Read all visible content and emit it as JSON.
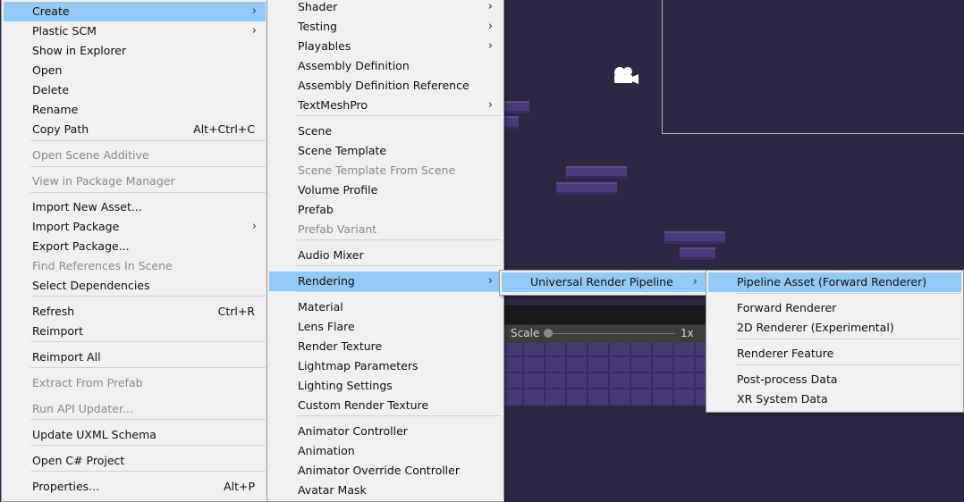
{
  "scene": {
    "scale_label": "Scale",
    "scale_value": "1x",
    "scale_level": 0
  },
  "menu1": [
    {
      "label": "Create",
      "submenu": true,
      "highlighted": true
    },
    {
      "label": "Plastic SCM",
      "submenu": true
    },
    {
      "label": "Show in Explorer"
    },
    {
      "label": "Open"
    },
    {
      "label": "Delete"
    },
    {
      "label": "Rename"
    },
    {
      "label": "Copy Path",
      "shortcut": "Alt+Ctrl+C"
    },
    {
      "label": "Open Scene Additive",
      "disabled": true
    },
    {
      "label": "View in Package Manager",
      "disabled": true
    },
    {
      "label": "Import New Asset..."
    },
    {
      "label": "Import Package",
      "submenu": true
    },
    {
      "label": "Export Package..."
    },
    {
      "label": "Find References In Scene",
      "disabled": true
    },
    {
      "label": "Select Dependencies"
    },
    {
      "label": "Refresh",
      "shortcut": "Ctrl+R"
    },
    {
      "label": "Reimport"
    },
    {
      "label": "Reimport All"
    },
    {
      "label": "Extract From Prefab",
      "disabled": true
    },
    {
      "label": "Run API Updater...",
      "disabled": true
    },
    {
      "label": "Update UXML Schema"
    },
    {
      "label": "Open C# Project"
    },
    {
      "label": "Properties...",
      "shortcut": "Alt+P"
    }
  ],
  "menu2": [
    {
      "label": "Shader",
      "submenu": true
    },
    {
      "label": "Testing",
      "submenu": true
    },
    {
      "label": "Playables",
      "submenu": true
    },
    {
      "label": "Assembly Definition"
    },
    {
      "label": "Assembly Definition Reference"
    },
    {
      "label": "TextMeshPro",
      "submenu": true
    },
    {
      "label": "Scene"
    },
    {
      "label": "Scene Template"
    },
    {
      "label": "Scene Template From Scene",
      "disabled": true
    },
    {
      "label": "Volume Profile"
    },
    {
      "label": "Prefab"
    },
    {
      "label": "Prefab Variant",
      "disabled": true
    },
    {
      "label": "Audio Mixer"
    },
    {
      "label": "Rendering",
      "submenu": true,
      "highlighted": true
    },
    {
      "label": "Material"
    },
    {
      "label": "Lens Flare"
    },
    {
      "label": "Render Texture"
    },
    {
      "label": "Lightmap Parameters"
    },
    {
      "label": "Lighting Settings"
    },
    {
      "label": "Custom Render Texture"
    },
    {
      "label": "Animator Controller"
    },
    {
      "label": "Animation"
    },
    {
      "label": "Animator Override Controller"
    },
    {
      "label": "Avatar Mask"
    }
  ],
  "menu3": [
    {
      "label": "Universal Render Pipeline",
      "submenu": true,
      "highlighted": true
    }
  ],
  "menu4": [
    {
      "label": "Pipeline Asset (Forward Renderer)",
      "highlighted": true
    },
    {
      "label": "Forward Renderer"
    },
    {
      "label": "2D Renderer (Experimental)"
    },
    {
      "label": "Renderer Feature"
    },
    {
      "label": "Post-process Data"
    },
    {
      "label": "XR System Data"
    }
  ],
  "icons": {
    "submenu_arrow": "chevron-right-icon",
    "camera": "camera-gizmo-icon"
  },
  "colors": {
    "highlight": "#91c9f7",
    "menu_bg": "#f0f0f0",
    "scene_bg": "#2e2741",
    "disabled_text": "#8a8a8a"
  }
}
